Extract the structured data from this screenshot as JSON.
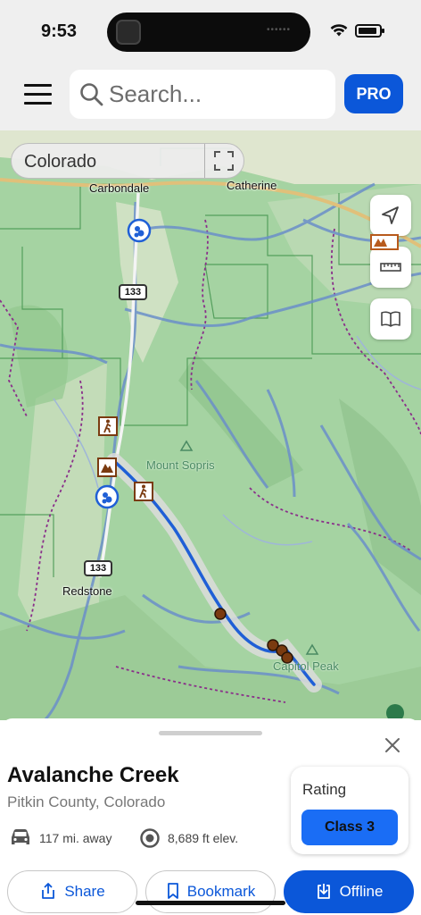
{
  "status_bar": {
    "time": "9:53",
    "battery_level": 0.9
  },
  "header": {
    "search_placeholder": "Search...",
    "pro_label": "PRO"
  },
  "map": {
    "region": "Colorado",
    "places": {
      "carbondale": "Carbondale",
      "catherine": "Catherine",
      "redstone": "Redstone"
    },
    "peaks": {
      "sopris": "Mount Sopris",
      "capitol": "Capitol Peak"
    },
    "road_shields": {
      "upper": "133",
      "lower": "133"
    },
    "icons": {
      "controls": [
        "navigation-arrow-icon",
        "ruler-icon",
        "book-icon"
      ],
      "pois": [
        "climbing-icon",
        "hiker-icon",
        "camp-icon",
        "hiker-icon",
        "climbing-icon",
        "rv-park-icon"
      ]
    },
    "colors": {
      "forest": "#9fcf9f",
      "route": "#1f5fd6",
      "river": "#6b8fc9",
      "boundary": "#8a2f8a"
    }
  },
  "sheet": {
    "title": "Avalanche Creek",
    "subtitle": "Pitkin County, Colorado",
    "distance": "117 mi. away",
    "elevation": "8,689 ft elev.",
    "rating_title": "Rating",
    "rating_value": "Class 3",
    "actions": {
      "share": "Share",
      "bookmark": "Bookmark",
      "offline": "Offline"
    }
  }
}
